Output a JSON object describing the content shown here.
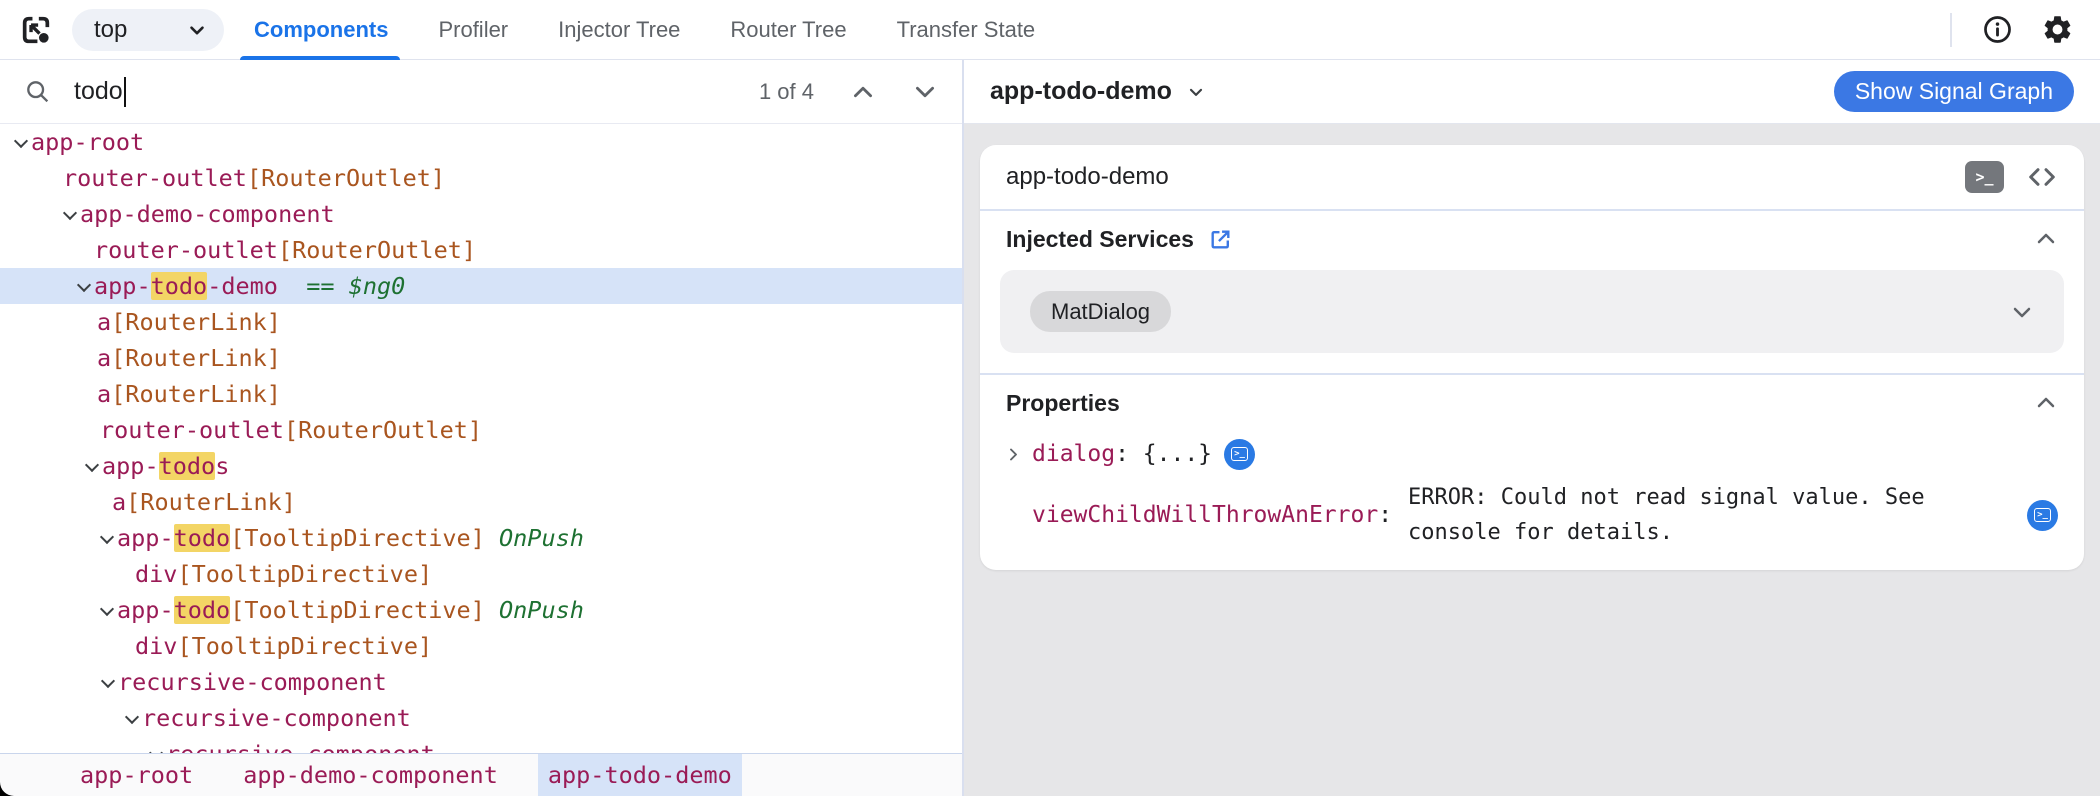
{
  "topbar": {
    "frame_selector": {
      "value": "top"
    },
    "tabs": [
      {
        "label": "Components",
        "active": true
      },
      {
        "label": "Profiler",
        "active": false
      },
      {
        "label": "Injector Tree",
        "active": false
      },
      {
        "label": "Router Tree",
        "active": false
      },
      {
        "label": "Transfer State",
        "active": false
      }
    ],
    "icons": [
      "component-picker-icon",
      "info-icon",
      "gear-icon"
    ]
  },
  "search": {
    "query": "todo",
    "results": "1 of 4"
  },
  "tree": {
    "rows": [
      {
        "indent": 10,
        "arrow": true,
        "selected": false,
        "segments": [
          {
            "t": "app-root",
            "c": "comp"
          }
        ]
      },
      {
        "indent": 63,
        "arrow": false,
        "selected": false,
        "segments": [
          {
            "t": "router-outlet",
            "c": "comp"
          },
          {
            "t": "[RouterOutlet]",
            "c": "dir"
          }
        ]
      },
      {
        "indent": 59,
        "arrow": true,
        "selected": false,
        "segments": [
          {
            "t": "app-demo-component",
            "c": "comp"
          }
        ]
      },
      {
        "indent": 94,
        "arrow": false,
        "selected": false,
        "segments": [
          {
            "t": "router-outlet",
            "c": "comp"
          },
          {
            "t": "[RouterOutlet]",
            "c": "dir"
          }
        ]
      },
      {
        "indent": 73,
        "arrow": true,
        "selected": true,
        "segments": [
          {
            "t": "app-",
            "c": "comp"
          },
          {
            "t": "todo",
            "c": "comp",
            "match": true
          },
          {
            "t": "-demo",
            "c": "comp"
          },
          {
            "t": "  == ",
            "c": "op"
          },
          {
            "t": "$ng0",
            "c": "ref"
          }
        ]
      },
      {
        "indent": 97,
        "arrow": false,
        "selected": false,
        "segments": [
          {
            "t": "a",
            "c": "comp"
          },
          {
            "t": "[RouterLink]",
            "c": "dir"
          }
        ]
      },
      {
        "indent": 97,
        "arrow": false,
        "selected": false,
        "segments": [
          {
            "t": "a",
            "c": "comp"
          },
          {
            "t": "[RouterLink]",
            "c": "dir"
          }
        ]
      },
      {
        "indent": 97,
        "arrow": false,
        "selected": false,
        "segments": [
          {
            "t": "a",
            "c": "comp"
          },
          {
            "t": "[RouterLink]",
            "c": "dir"
          }
        ]
      },
      {
        "indent": 100,
        "arrow": false,
        "selected": false,
        "segments": [
          {
            "t": "router-outlet",
            "c": "comp"
          },
          {
            "t": "[RouterOutlet]",
            "c": "dir"
          }
        ]
      },
      {
        "indent": 81,
        "arrow": true,
        "selected": false,
        "segments": [
          {
            "t": "app-",
            "c": "comp"
          },
          {
            "t": "todo",
            "c": "comp",
            "match": true
          },
          {
            "t": "s",
            "c": "comp"
          }
        ]
      },
      {
        "indent": 112,
        "arrow": false,
        "selected": false,
        "segments": [
          {
            "t": "a",
            "c": "comp"
          },
          {
            "t": "[RouterLink]",
            "c": "dir"
          }
        ]
      },
      {
        "indent": 96,
        "arrow": true,
        "selected": false,
        "segments": [
          {
            "t": "app-",
            "c": "comp"
          },
          {
            "t": "todo",
            "c": "comp",
            "match": true
          },
          {
            "t": "[TooltipDirective]",
            "c": "dir"
          },
          {
            "t": " OnPush",
            "c": "onpush"
          }
        ]
      },
      {
        "indent": 135,
        "arrow": false,
        "selected": false,
        "segments": [
          {
            "t": "div",
            "c": "comp"
          },
          {
            "t": "[TooltipDirective]",
            "c": "dir"
          }
        ]
      },
      {
        "indent": 96,
        "arrow": true,
        "selected": false,
        "segments": [
          {
            "t": "app-",
            "c": "comp"
          },
          {
            "t": "todo",
            "c": "comp",
            "match": true
          },
          {
            "t": "[TooltipDirective]",
            "c": "dir"
          },
          {
            "t": " OnPush",
            "c": "onpush"
          }
        ]
      },
      {
        "indent": 135,
        "arrow": false,
        "selected": false,
        "segments": [
          {
            "t": "div",
            "c": "comp"
          },
          {
            "t": "[TooltipDirective]",
            "c": "dir"
          }
        ]
      },
      {
        "indent": 97,
        "arrow": true,
        "selected": false,
        "segments": [
          {
            "t": "recursive-component",
            "c": "comp"
          }
        ]
      },
      {
        "indent": 121,
        "arrow": true,
        "selected": false,
        "segments": [
          {
            "t": "recursive-component",
            "c": "comp"
          }
        ]
      },
      {
        "indent": 145,
        "arrow": true,
        "selected": false,
        "segments": [
          {
            "t": "recursive-component",
            "c": "comp"
          }
        ]
      }
    ]
  },
  "breadcrumbs": [
    {
      "label": "app-root",
      "selected": false
    },
    {
      "label": "app-demo-component",
      "selected": false
    },
    {
      "label": "app-todo-demo",
      "selected": true
    }
  ],
  "details": {
    "selected_component": "app-todo-demo",
    "show_signal_graph": "Show Signal Graph",
    "card_title": "app-todo-demo",
    "injected_services": {
      "title": "Injected Services",
      "services": [
        "MatDialog"
      ]
    },
    "properties": {
      "title": "Properties",
      "rows": [
        {
          "name": "dialog",
          "colon": ": ",
          "value": "{...}",
          "expandable": true,
          "display": "inline",
          "console_icon": true
        },
        {
          "name": "viewChildWillThrowAnError",
          "colon": ":",
          "value": "ERROR: Could not read signal value. See console for details.",
          "expandable": false,
          "display": "block",
          "console_icon": true
        }
      ]
    }
  },
  "colors": {
    "accent_blue": "#1a73e8",
    "button_blue": "#3b78e4",
    "selection_blue": "#d6e3f8",
    "component_name": "#9a1b56",
    "directive_name": "#a9551f",
    "meta_green": "#1e7132",
    "match_highlight": "#f3d565",
    "panel_gray": "#e6e6e8"
  }
}
